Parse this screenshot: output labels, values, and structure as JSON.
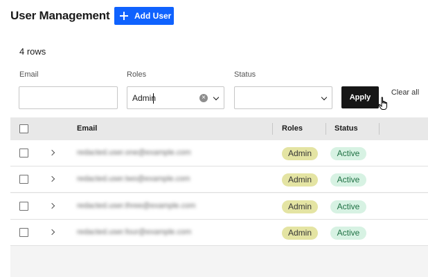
{
  "header": {
    "title": "User Management",
    "add_user_label": "Add User"
  },
  "table_summary": {
    "row_count": "4 rows"
  },
  "filters": {
    "email_label": "Email",
    "email_value": "",
    "roles_label": "Roles",
    "roles_value": "Admin",
    "status_label": "Status",
    "status_value": "",
    "apply_label": "Apply",
    "clear_all_label": "Clear all"
  },
  "table": {
    "columns": [
      "Email",
      "Roles",
      "Status"
    ],
    "rows": [
      {
        "email": "redacted.user.one@example.com",
        "role": "Admin",
        "status": "Active"
      },
      {
        "email": "redacted.user.two@example.com",
        "role": "Admin",
        "status": "Active"
      },
      {
        "email": "redacted.user.three@example.com",
        "role": "Admin",
        "status": "Active"
      },
      {
        "email": "redacted.user.four@example.com",
        "role": "Admin",
        "status": "Active"
      }
    ]
  },
  "colors": {
    "primary": "#0f62fe",
    "apply_bg": "#161616",
    "role_badge_bg": "#e4e4a3",
    "status_badge_bg": "#d7f2e3",
    "status_badge_text": "#1d6f42"
  }
}
